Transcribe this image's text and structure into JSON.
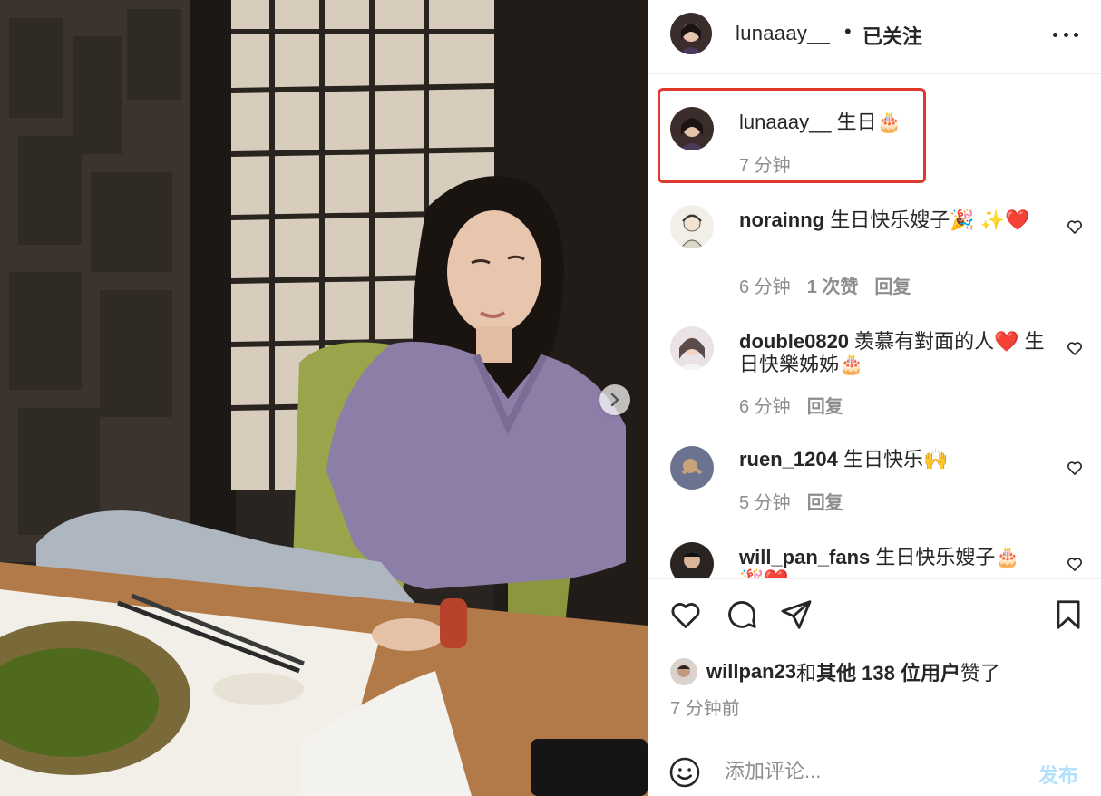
{
  "header": {
    "username": "lunaaay__",
    "dot": "•",
    "follow_label": "已关注"
  },
  "caption": {
    "username": "lunaaay__",
    "text": "生日🎂",
    "time": "7 分钟"
  },
  "comments": [
    {
      "username": "norainng",
      "text": "生日快乐嫂子🎉 ✨❤️",
      "time": "6 分钟",
      "likes": "1 次赞",
      "reply": "回复"
    },
    {
      "username": "double0820",
      "text": "羡慕有對面的人❤️ 生日快樂姊姊🎂",
      "time": "6 分钟",
      "reply": "回复"
    },
    {
      "username": "ruen_1204",
      "text": "生日快乐🙌",
      "time": "5 分钟",
      "reply": "回复"
    },
    {
      "username": "will_pan_fans",
      "text": "生日快乐嫂子🎂 🎉❤️"
    }
  ],
  "likes": {
    "user": "willpan23",
    "and": " 和 ",
    "others": "其他 138 位用户",
    "suffix": " 赞了"
  },
  "time_ago": "7 分钟前",
  "add_comment": {
    "placeholder": "添加评论...",
    "post_label": "发布"
  },
  "colors": {
    "highlight": "#e0392b",
    "post_disabled": "#b2dffc",
    "muted": "#8e8e8e"
  }
}
